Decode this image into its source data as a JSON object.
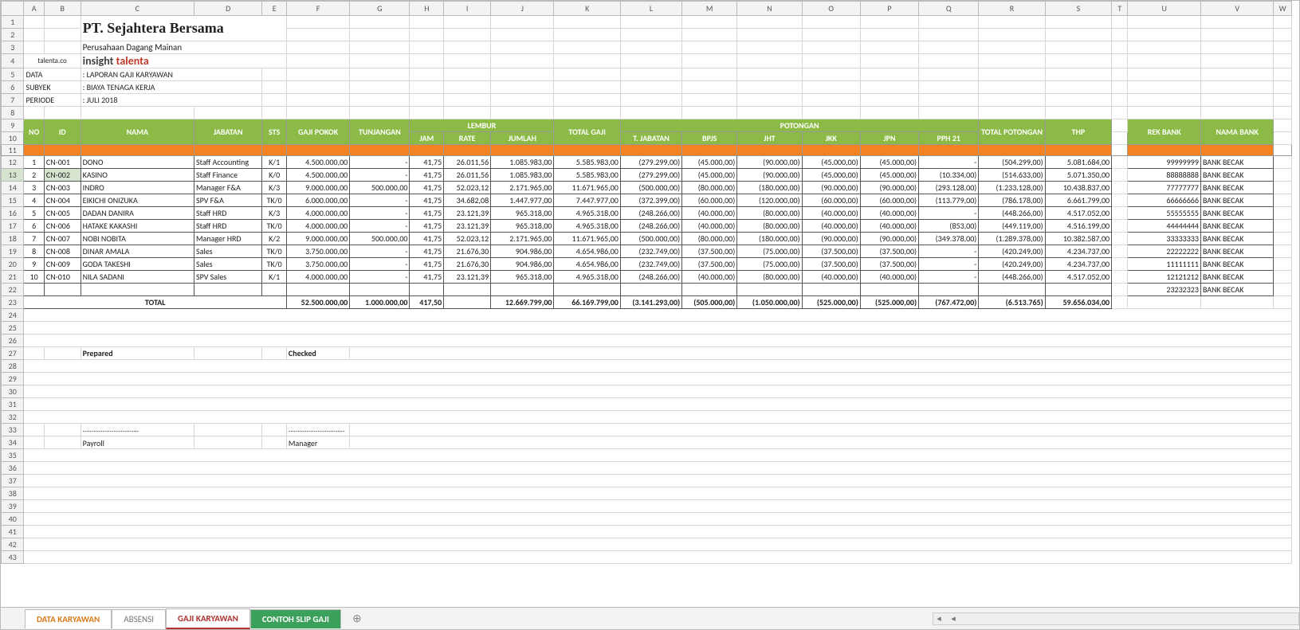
{
  "cols": [
    "",
    "A",
    "B",
    "C",
    "D",
    "E",
    "F",
    "G",
    "H",
    "I",
    "J",
    "K",
    "L",
    "M",
    "N",
    "O",
    "P",
    "Q",
    "R",
    "S",
    "T",
    "U",
    "V",
    "W"
  ],
  "company": {
    "name": "PT. Sejahtera Bersama",
    "sub": "Perusahaan Dagang Mainan",
    "brand1": "insight ",
    "brand2": "talenta",
    "site": "talenta.co"
  },
  "meta": {
    "dataL": "DATA",
    "dataV": ": LAPORAN GAJI KARYAWAN",
    "subL": "SUBYEK",
    "subV": ": BIAYA TENAGA KERJA",
    "perL": "PERIODE",
    "perV": ": JULI 2018"
  },
  "hdr": {
    "no": "NO",
    "id": "ID",
    "nama": "NAMA",
    "jab": "JABATAN",
    "sts": "STS",
    "gp": "GAJI POKOK",
    "tun": "TUNJANGAN",
    "lembur": "LEMBUR",
    "jam": "JAM",
    "rate": "RATE",
    "jum": "JUMLAH",
    "tg": "TOTAL GAJI",
    "pot": "POTONGAN",
    "tj": "T. JABATAN",
    "bpjs": "BPJS",
    "jht": "JHT",
    "jkk": "JKK",
    "jpn": "JPN",
    "pph": "PPH 21",
    "tpot": "TOTAL POTONGAN",
    "thp": "THP",
    "rek": "REK BANK",
    "bank": "NAMA BANK"
  },
  "rows": [
    {
      "no": "1",
      "id": "CN-001",
      "nama": "DONO",
      "jab": "Staff Accounting",
      "sts": "K/1",
      "gp": "4.500.000,00",
      "tun": "-",
      "jam": "41,75",
      "rate": "26.011,56",
      "jum": "1.085.983,00",
      "tg": "5.585.983,00",
      "tj": "(279.299,00)",
      "bpjs": "(45.000,00)",
      "jht": "(90.000,00)",
      "jkk": "(45.000,00)",
      "jpn": "(45.000,00)",
      "pph": "-",
      "tpot": "(504.299,00)",
      "thp": "5.081.684,00",
      "rek": "99999999",
      "bank": "BANK BECAK"
    },
    {
      "no": "2",
      "id": "CN-002",
      "nama": "KASINO",
      "jab": "Staff Finance",
      "sts": "K/0",
      "gp": "4.500.000,00",
      "tun": "-",
      "jam": "41,75",
      "rate": "26.011,56",
      "jum": "1.085.983,00",
      "tg": "5.585.983,00",
      "tj": "(279.299,00)",
      "bpjs": "(45.000,00)",
      "jht": "(90.000,00)",
      "jkk": "(45.000,00)",
      "jpn": "(45.000,00)",
      "pph": "(10.334,00)",
      "tpot": "(514.633,00)",
      "thp": "5.071.350,00",
      "rek": "88888888",
      "bank": "BANK BECAK"
    },
    {
      "no": "3",
      "id": "CN-003",
      "nama": "INDRO",
      "jab": "Manager F&A",
      "sts": "K/3",
      "gp": "9.000.000,00",
      "tun": "500.000,00",
      "jam": "41,75",
      "rate": "52.023,12",
      "jum": "2.171.965,00",
      "tg": "11.671.965,00",
      "tj": "(500.000,00)",
      "bpjs": "(80.000,00)",
      "jht": "(180.000,00)",
      "jkk": "(90.000,00)",
      "jpn": "(90.000,00)",
      "pph": "(293.128,00)",
      "tpot": "(1.233.128,00)",
      "thp": "10.438.837,00",
      "rek": "77777777",
      "bank": "BANK BECAK"
    },
    {
      "no": "4",
      "id": "CN-004",
      "nama": "EIKICHI ONIZUKA",
      "jab": "SPV F&A",
      "sts": "TK/0",
      "gp": "6.000.000,00",
      "tun": "-",
      "jam": "41,75",
      "rate": "34.682,08",
      "jum": "1.447.977,00",
      "tg": "7.447.977,00",
      "tj": "(372.399,00)",
      "bpjs": "(60.000,00)",
      "jht": "(120.000,00)",
      "jkk": "(60.000,00)",
      "jpn": "(60.000,00)",
      "pph": "(113.779,00)",
      "tpot": "(786.178,00)",
      "thp": "6.661.799,00",
      "rek": "66666666",
      "bank": "BANK BECAK"
    },
    {
      "no": "5",
      "id": "CN-005",
      "nama": "DADAN DANIRA",
      "jab": "Staff HRD",
      "sts": "K/3",
      "gp": "4.000.000,00",
      "tun": "-",
      "jam": "41,75",
      "rate": "23.121,39",
      "jum": "965.318,00",
      "tg": "4.965.318,00",
      "tj": "(248.266,00)",
      "bpjs": "(40.000,00)",
      "jht": "(80.000,00)",
      "jkk": "(40.000,00)",
      "jpn": "(40.000,00)",
      "pph": "-",
      "tpot": "(448.266,00)",
      "thp": "4.517.052,00",
      "rek": "55555555",
      "bank": "BANK BECAK"
    },
    {
      "no": "6",
      "id": "CN-006",
      "nama": "HATAKE KAKASHI",
      "jab": "Staff HRD",
      "sts": "TK/0",
      "gp": "4.000.000,00",
      "tun": "-",
      "jam": "41,75",
      "rate": "23.121,39",
      "jum": "965.318,00",
      "tg": "4.965.318,00",
      "tj": "(248.266,00)",
      "bpjs": "(40.000,00)",
      "jht": "(80.000,00)",
      "jkk": "(40.000,00)",
      "jpn": "(40.000,00)",
      "pph": "(853,00)",
      "tpot": "(449.119,00)",
      "thp": "4.516.199,00",
      "rek": "44444444",
      "bank": "BANK BECAK"
    },
    {
      "no": "7",
      "id": "CN-007",
      "nama": "NOBI NOBITA",
      "jab": "Manager HRD",
      "sts": "K/2",
      "gp": "9.000.000,00",
      "tun": "500.000,00",
      "jam": "41,75",
      "rate": "52.023,12",
      "jum": "2.171.965,00",
      "tg": "11.671.965,00",
      "tj": "(500.000,00)",
      "bpjs": "(80.000,00)",
      "jht": "(180.000,00)",
      "jkk": "(90.000,00)",
      "jpn": "(90.000,00)",
      "pph": "(349.378,00)",
      "tpot": "(1.289.378,00)",
      "thp": "10.382.587,00",
      "rek": "33333333",
      "bank": "BANK BECAK"
    },
    {
      "no": "8",
      "id": "CN-008",
      "nama": "DINAR AMALA",
      "jab": "Sales",
      "sts": "TK/0",
      "gp": "3.750.000,00",
      "tun": "-",
      "jam": "41,75",
      "rate": "21.676,30",
      "jum": "904.986,00",
      "tg": "4.654.986,00",
      "tj": "(232.749,00)",
      "bpjs": "(37.500,00)",
      "jht": "(75.000,00)",
      "jkk": "(37.500,00)",
      "jpn": "(37.500,00)",
      "pph": "-",
      "tpot": "(420.249,00)",
      "thp": "4.234.737,00",
      "rek": "22222222",
      "bank": "BANK BECAK"
    },
    {
      "no": "9",
      "id": "CN-009",
      "nama": "GODA TAKESHI",
      "jab": "Sales",
      "sts": "TK/0",
      "gp": "3.750.000,00",
      "tun": "-",
      "jam": "41,75",
      "rate": "21.676,30",
      "jum": "904.986,00",
      "tg": "4.654.986,00",
      "tj": "(232.749,00)",
      "bpjs": "(37.500,00)",
      "jht": "(75.000,00)",
      "jkk": "(37.500,00)",
      "jpn": "(37.500,00)",
      "pph": "-",
      "tpot": "(420.249,00)",
      "thp": "4.234.737,00",
      "rek": "11111111",
      "bank": "BANK BECAK"
    },
    {
      "no": "10",
      "id": "CN-010",
      "nama": "NILA SADANI",
      "jab": "SPV Sales",
      "sts": "K/1",
      "gp": "4.000.000,00",
      "tun": "-",
      "jam": "41,75",
      "rate": "23.121,39",
      "jum": "965.318,00",
      "tg": "4.965.318,00",
      "tj": "(248.266,00)",
      "bpjs": "(40.000,00)",
      "jht": "(80.000,00)",
      "jkk": "(40.000,00)",
      "jpn": "(40.000,00)",
      "pph": "-",
      "tpot": "(448.266,00)",
      "thp": "4.517.052,00",
      "rek": "12121212",
      "bank": "BANK BECAK"
    }
  ],
  "extra": {
    "rek": "23232323",
    "bank": "BANK BECAK"
  },
  "total": {
    "label": "TOTAL",
    "gp": "52.500.000,00",
    "tun": "1.000.000,00",
    "jam": "417,50",
    "rate": "",
    "jum": "12.669.799,00",
    "tg": "66.169.799,00",
    "tj": "(3.141.293,00)",
    "bpjs": "(505.000,00)",
    "jht": "(1.050.000,00)",
    "jkk": "(525.000,00)",
    "jpn": "(525.000,00)",
    "pph": "(767.472,00)",
    "tpot": "(6.513.765)",
    "thp": "59.656.034,00"
  },
  "sign": {
    "prep": "Prepared",
    "check": "Checked",
    "dots": "...............................",
    "pay": "Payroll",
    "mgr": "Manager"
  },
  "tabs": {
    "t1": "DATA KARYAWAN",
    "t2": "ABSENSI",
    "t3": "GAJI KARYAWAN",
    "t4": "CONTOH SLIP GAJI"
  }
}
